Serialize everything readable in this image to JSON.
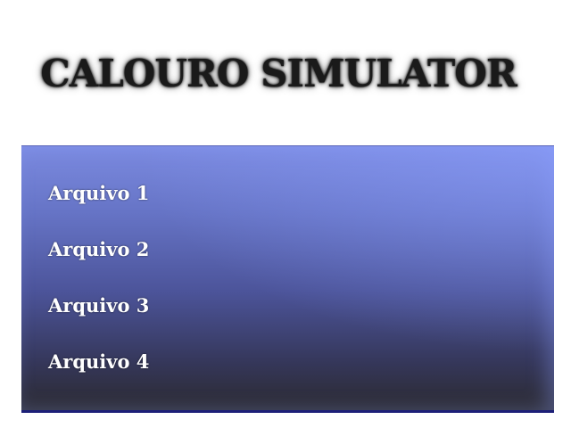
{
  "title": "CALOURO SIMULATOR",
  "menu": {
    "slots": [
      {
        "label": "Arquivo 1"
      },
      {
        "label": "Arquivo 2"
      },
      {
        "label": "Arquivo 3"
      },
      {
        "label": "Arquivo 4"
      }
    ]
  },
  "colors": {
    "panel_top": "#7b8ae0",
    "panel_bottom": "#2b2a30",
    "panel_border": "#1c1f78",
    "title_text": "#1a1a1a",
    "slot_text": "#ffffff"
  }
}
